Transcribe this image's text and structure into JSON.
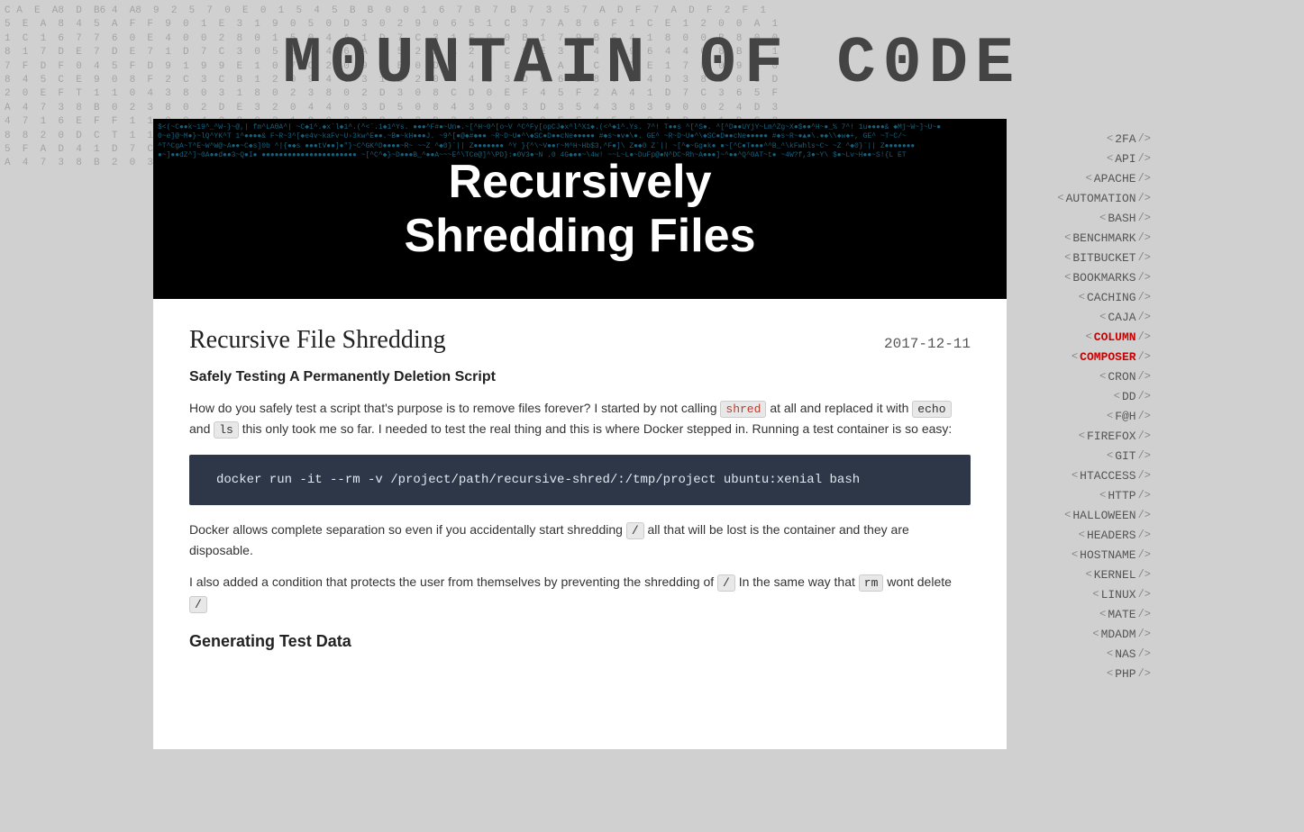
{
  "site": {
    "title": "M0UNTAIN 0F C0DE"
  },
  "hero": {
    "line1": "Recursively",
    "line2": "Shredding Files"
  },
  "article": {
    "title": "Recursive File Shredding",
    "date": "2017-12-11",
    "subtitle": "Safely Testing A Permanently Deletion Script",
    "paragraph1": "How do you safely test a script that's purpose is to remove files forever? I started by not calling",
    "code_shred": "shred",
    "paragraph1b": "at all and replaced it with",
    "code_echo": "echo",
    "word_and": "and",
    "code_ls": "ls",
    "paragraph1c": "this only took me so far. I needed to test the real thing and this is where Docker stepped in. Running a test container is so easy:",
    "code_block": "docker run -it --rm -v /project/path/recursive-shred/:/tmp/project ubuntu:xenial bash",
    "paragraph2": "Docker allows complete separation so even if you accidentally start shredding",
    "code_slash1": "/",
    "paragraph2b": "all that will be lost is the container and they are disposable.",
    "paragraph3": "I also added a condition that protects the user from themselves by preventing the shredding of",
    "code_slash2": "/",
    "paragraph3b": "In the same way that",
    "code_rm": "rm",
    "paragraph3c": "wont delete",
    "code_slash3": "/",
    "section_heading": "Generating Test Data"
  },
  "sidebar": {
    "items": [
      {
        "label": "2FA",
        "active": false
      },
      {
        "label": "API",
        "active": false
      },
      {
        "label": "APACHE",
        "active": false
      },
      {
        "label": "AUTOMATION",
        "active": false
      },
      {
        "label": "BASH",
        "active": false
      },
      {
        "label": "BENCHMARK",
        "active": false
      },
      {
        "label": "BITBUCKET",
        "active": false
      },
      {
        "label": "BOOKMARKS",
        "active": false
      },
      {
        "label": "CACHING",
        "active": false
      },
      {
        "label": "CAJA",
        "active": false
      },
      {
        "label": "COLUMN",
        "active": true
      },
      {
        "label": "COMPOSER",
        "active": true
      },
      {
        "label": "CRON",
        "active": false
      },
      {
        "label": "DD",
        "active": false
      },
      {
        "label": "F@H",
        "active": false
      },
      {
        "label": "FIREFOX",
        "active": false
      },
      {
        "label": "GIT",
        "active": false
      },
      {
        "label": "HTACCESS",
        "active": false
      },
      {
        "label": "HTTP",
        "active": false
      },
      {
        "label": "HALLOWEEN",
        "active": false
      },
      {
        "label": "HEADERS",
        "active": false
      },
      {
        "label": "HOSTNAME",
        "active": false
      },
      {
        "label": "KERNEL",
        "active": false
      },
      {
        "label": "LINUX",
        "active": false
      },
      {
        "label": "MATE",
        "active": false
      },
      {
        "label": "MDADM",
        "active": false
      },
      {
        "label": "NAS",
        "active": false
      },
      {
        "label": "PHP",
        "active": false
      }
    ]
  },
  "bg_matrix_chars": "CA E A8 D B6 4 A8 9 2 5 7 0 E 0 1 5 4 5 B B 0 0 1 6 7 B 7 B 7 3 5 7 A D F 7 A D F 2 F 1 5 E A 8 4 5 A F F 9 0 1 E 3 1 9 0 5 0 D 3 0 2 9 0 6 5 1 C 3 7 A 8 6 F 1 C E 1 2 0 0 A 1 5 1 C 1 6 7 7 6 0 E 4 0 0 2 8 0 1 5 0 4 A 1 D 7 C 3 1 F 0 0 B 1 7 9 B F 4 1 8 0 0 B 8 0 0 8 1 7 D E 7 D E 7 1 D 7 C 3 0 5 0 4 4 6 A N 5 2 2 A 2 0 C 8 E 3 E 4 7 9 6 4 4 C 8 B E 1 7 F D F 0 4 5 F D 9 1 9 9 E 1 0 7 C 2 0 9 4 E 0 D 6 4 1 E C E A 4 C B B E 1 7 F 0 9 1 0 8 4 5 C E 9 0 8 4 6"
}
